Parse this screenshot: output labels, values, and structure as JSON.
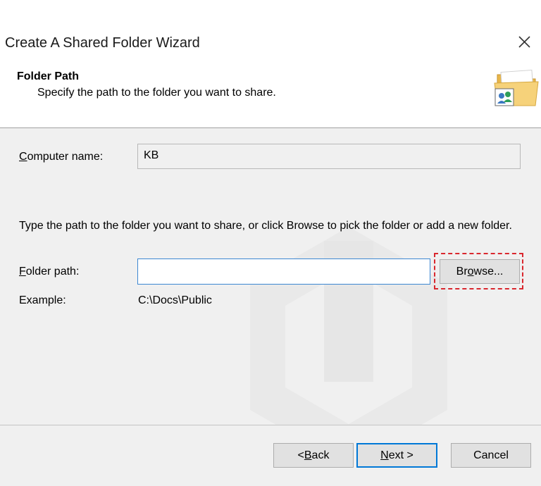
{
  "window": {
    "title": "Create A Shared Folder Wizard",
    "close_icon": "close-icon"
  },
  "header": {
    "title": "Folder Path",
    "subtitle": "Specify the path to the folder you want to share.",
    "icon": "shared-folder-icon"
  },
  "form": {
    "computer_name": {
      "label_accel": "C",
      "label_rest": "omputer name:",
      "value": "KB"
    },
    "instructions": "Type the path to the folder you want to share, or click Browse to pick the folder or add a new folder.",
    "folder_path": {
      "label_accel": "F",
      "label_rest": "older path:",
      "value": "",
      "placeholder": ""
    },
    "browse": {
      "pre": "Br",
      "accel": "o",
      "post": "wse..."
    },
    "example": {
      "label": "Example:",
      "value": "C:\\Docs\\Public"
    }
  },
  "buttons": {
    "back": {
      "pre": "< ",
      "accel": "B",
      "post": "ack"
    },
    "next": {
      "pre": "",
      "accel": "N",
      "post": "ext >"
    },
    "cancel": "Cancel"
  },
  "colors": {
    "background": "#f0f0f0",
    "focus_border": "#0078d7",
    "highlight": "#d9272e"
  }
}
